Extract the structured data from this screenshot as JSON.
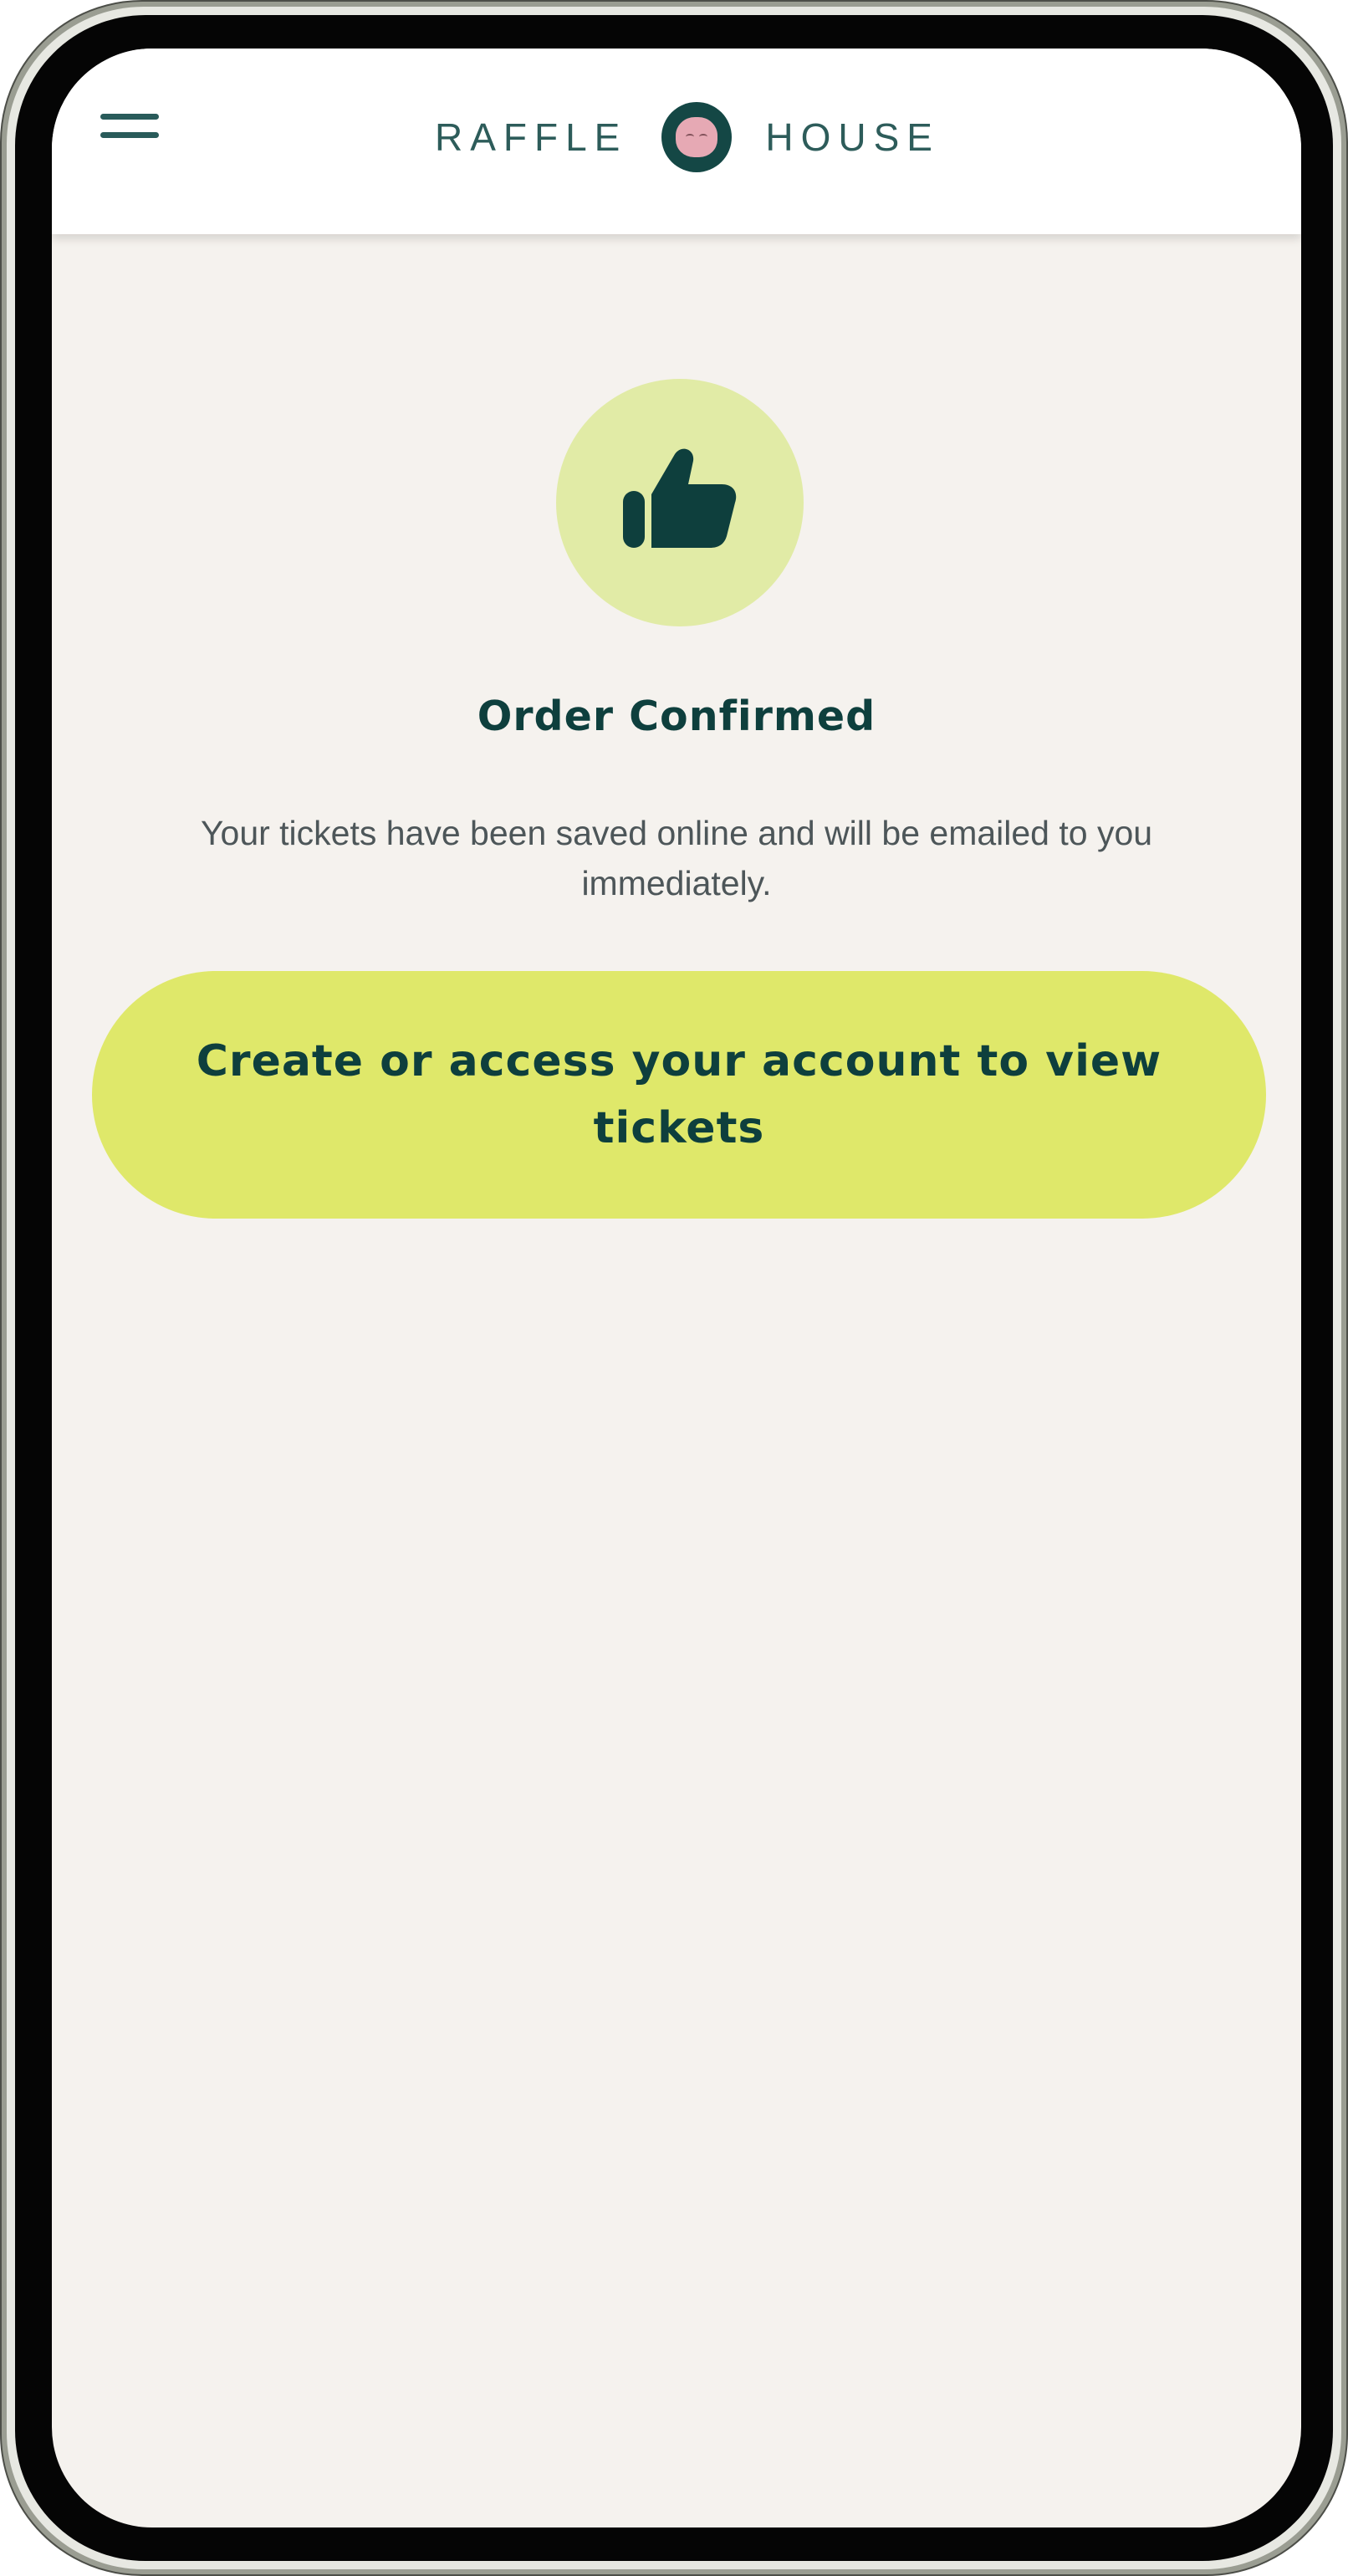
{
  "header": {
    "logo_left": "RAFFLE",
    "logo_right": "HOUSE",
    "menu_icon": "hamburger-menu-icon",
    "logo_icon": "pig-logo-icon"
  },
  "confirmation": {
    "icon": "thumbs-up-icon",
    "title": "Order Confirmed",
    "message": "Your tickets have been saved online and will be emailed to you immediately."
  },
  "cta": {
    "label": "Create or access your account to view tickets"
  },
  "colors": {
    "brand_dark": "#0e3f3d",
    "accent_lime": "#dfe86a",
    "icon_circle": "#e1eba6",
    "background": "#f5f2ee"
  }
}
